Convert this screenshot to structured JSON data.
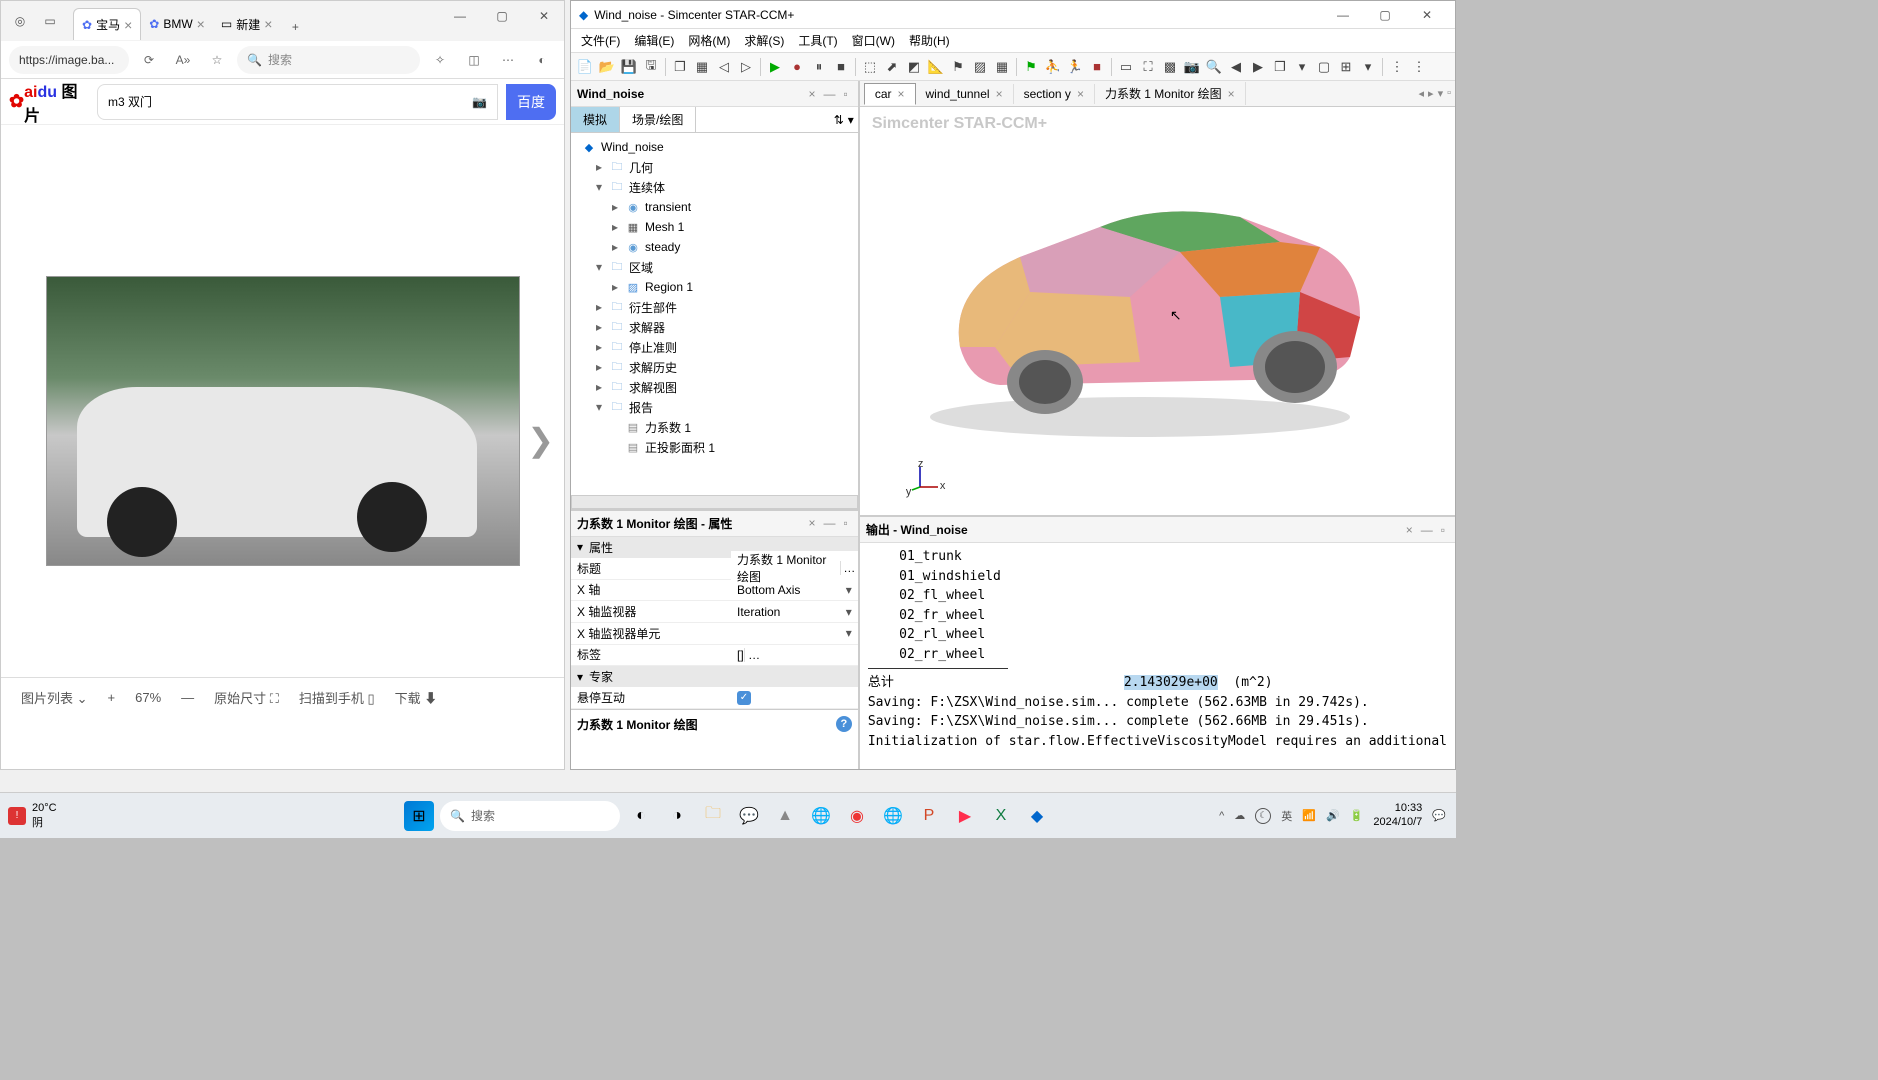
{
  "browser": {
    "tabs": [
      {
        "label": "宝马",
        "active": true
      },
      {
        "label": "BMW",
        "active": false
      },
      {
        "label": "新建",
        "active": false
      }
    ],
    "url": "https://image.ba...",
    "search_placeholder": "搜索",
    "baidu": {
      "logo_text": "图片",
      "query": "m3 双门",
      "button": "百度"
    },
    "bottombar": {
      "list": "图片列表",
      "zoom_plus": "+",
      "zoom_pct": "67%",
      "zoom_minus": "—",
      "original": "原始尺寸",
      "scan": "扫描到手机",
      "download": "下载"
    }
  },
  "starccm": {
    "title": "Wind_noise - Simcenter STAR-CCM+",
    "menus": [
      "文件(F)",
      "编辑(E)",
      "网格(M)",
      "求解(S)",
      "工具(T)",
      "窗口(W)",
      "帮助(H)"
    ],
    "sim_panel_title": "Wind_noise",
    "sim_tabs": {
      "sim": "模拟",
      "scene": "场景/绘图"
    },
    "tree": {
      "root": "Wind_noise",
      "geometry": "几何",
      "continua": "连续体",
      "transient": "transient",
      "mesh1": "Mesh 1",
      "steady": "steady",
      "regions": "区域",
      "region1": "Region 1",
      "derived": "衍生部件",
      "solvers": "求解器",
      "stopping": "停止准则",
      "history": "求解历史",
      "views": "求解视图",
      "reports": "报告",
      "force1": "力系数 1",
      "projarea": "正投影面积 1"
    },
    "props": {
      "title": "力系数 1 Monitor 绘图 - 属性",
      "section_props": "属性",
      "row_title_label": "标题",
      "row_title_val": "力系数 1 Monitor 绘图",
      "row_xaxis_label": "X 轴",
      "row_xaxis_val": "Bottom Axis",
      "row_xmon_label": "X 轴监视器",
      "row_xmon_val": "Iteration",
      "row_xmonunit_label": "X 轴监视器单元",
      "row_xmonunit_val": "",
      "row_tags_label": "标签",
      "row_tags_val": "[]",
      "section_expert": "专家",
      "row_hover_label": "悬停互动",
      "description": "力系数 1 Monitor 绘图"
    },
    "view_tabs": [
      "car",
      "wind_tunnel",
      "section y",
      "力系数 1 Monitor 绘图"
    ],
    "watermark": "Simcenter STAR-CCM+",
    "axis": {
      "z": "z",
      "y": "y",
      "x": "x"
    },
    "output": {
      "title": "输出 - Wind_noise",
      "lines": [
        "    01_trunk",
        "    01_windshield",
        "    02_fl_wheel",
        "    02_fr_wheel",
        "    02_rl_wheel",
        "    02_rr_wheel"
      ],
      "total_label": "总计",
      "total_val": "2.143029e+00",
      "total_unit": "(m^2)",
      "save1": "Saving: F:\\ZSX\\Wind_noise.sim... complete (562.63MB in 29.742s).",
      "save2": "Saving: F:\\ZSX\\Wind_noise.sim... complete (562.66MB in 29.451s).",
      "init": "Initialization of star.flow.EffectiveViscosityModel requires an additional"
    }
  },
  "taskbar": {
    "weather_temp": "20°C",
    "weather_cond": "阴",
    "search": "搜索",
    "time": "10:33",
    "date": "2024/10/7"
  }
}
